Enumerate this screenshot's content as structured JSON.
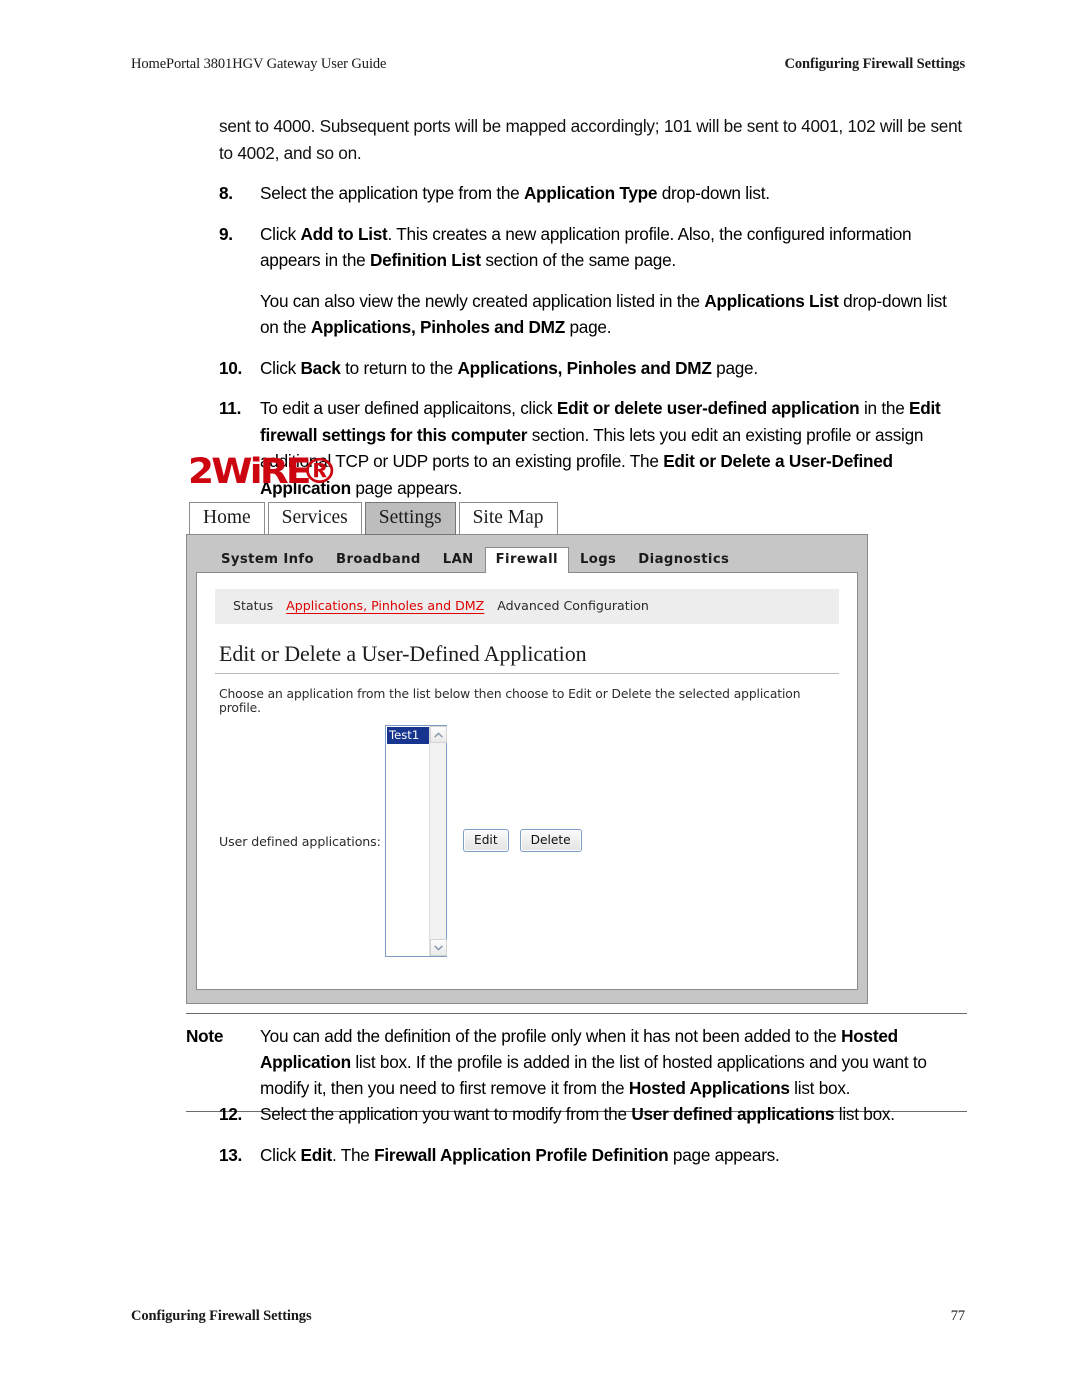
{
  "header": {
    "left": "HomePortal 3801HGV Gateway User Guide",
    "right": "Configuring Firewall Settings"
  },
  "footer": {
    "left": "Configuring Firewall Settings",
    "page_number": "77"
  },
  "body": {
    "lead_paragraph": {
      "line1_a": "sent to 4000. Subsequent ports will be mapped accordingly; 101 will be sent to 4001, 102 will be sent to 4002, and so on."
    },
    "steps": [
      {
        "number": "8.",
        "parts": [
          {
            "text": "Select the application type from the ",
            "bold": false
          },
          {
            "text": "Application Type",
            "bold": true
          },
          {
            "text": " drop-down list.",
            "bold": false
          }
        ]
      },
      {
        "number": "9.",
        "parts": [
          {
            "text": "Click ",
            "bold": false
          },
          {
            "text": "Add to List",
            "bold": true
          },
          {
            "text": ". This creates a new application profile. Also, the configured information appears in the ",
            "bold": false
          },
          {
            "text": "Definition List",
            "bold": true
          },
          {
            "text": " section of the same page.",
            "bold": false
          }
        ]
      }
    ],
    "sub_paragraph": [
      {
        "text": "You can also view the newly created application listed in the ",
        "bold": false
      },
      {
        "text": "Applications List",
        "bold": true
      },
      {
        "text": " drop-down list on the ",
        "bold": false
      },
      {
        "text": "Applications, Pinholes and DMZ",
        "bold": true
      },
      {
        "text": " page.",
        "bold": false
      }
    ],
    "steps2": [
      {
        "number": "10.",
        "parts": [
          {
            "text": "Click ",
            "bold": false
          },
          {
            "text": "Back",
            "bold": true
          },
          {
            "text": " to return to the ",
            "bold": false
          },
          {
            "text": "Applications, Pinholes and DMZ",
            "bold": true
          },
          {
            "text": " page.",
            "bold": false
          }
        ]
      },
      {
        "number": "11.",
        "parts": [
          {
            "text": "To edit a user defined applicaitons, click ",
            "bold": false
          },
          {
            "text": "Edit or delete user-defined application",
            "bold": true
          },
          {
            "text": " in the ",
            "bold": false
          },
          {
            "text": "Edit firewall settings for this computer",
            "bold": true
          },
          {
            "text": " section. This lets you edit an existing profile or assign additional TCP or UDP ports to an existing profile. The ",
            "bold": false
          },
          {
            "text": "Edit or Delete a User-Defined Application",
            "bold": true
          },
          {
            "text": " page appears.",
            "bold": false
          }
        ]
      }
    ],
    "steps3": [
      {
        "number": "12.",
        "parts": [
          {
            "text": "Select the application you want to modify from the ",
            "bold": false
          },
          {
            "text": "User defined applications",
            "bold": true
          },
          {
            "text": " list box.",
            "bold": false
          }
        ]
      },
      {
        "number": "13.",
        "parts": [
          {
            "text": "Click ",
            "bold": false
          },
          {
            "text": "Edit",
            "bold": true
          },
          {
            "text": ". The ",
            "bold": false
          },
          {
            "text": "Firewall Application Profile Definition",
            "bold": true
          },
          {
            "text": " page appears.",
            "bold": false
          }
        ]
      }
    ],
    "note": {
      "label": "Note",
      "parts": [
        {
          "text": "You can add the definition of the profile only when it has not been added to the ",
          "bold": false
        },
        {
          "text": "Hosted Application",
          "bold": true
        },
        {
          "text": " list box. If the profile is added in the list of hosted applications and you want to modify it, then you need to first remove it from the ",
          "bold": false
        },
        {
          "text": "Hosted Applications",
          "bold": true
        },
        {
          "text": " list box.",
          "bold": false
        }
      ]
    }
  },
  "screenshot": {
    "logo": {
      "text": "2WiRE",
      "registered_mark": "®",
      "color": "#cc0511"
    },
    "primary_tabs": [
      {
        "label": "Home",
        "active": false
      },
      {
        "label": "Services",
        "active": false
      },
      {
        "label": "Settings",
        "active": true
      },
      {
        "label": "Site Map",
        "active": false
      }
    ],
    "secondary_tabs": [
      {
        "label": "System Info",
        "active": false
      },
      {
        "label": "Broadband",
        "active": false
      },
      {
        "label": "LAN",
        "active": false
      },
      {
        "label": "Firewall",
        "active": true
      },
      {
        "label": "Logs",
        "active": false
      },
      {
        "label": "Diagnostics",
        "active": false
      }
    ],
    "subnav": [
      {
        "label": "Status",
        "active": false
      },
      {
        "label": "Applications, Pinholes and DMZ",
        "active": true
      },
      {
        "label": "Advanced Configuration",
        "active": false
      }
    ],
    "subnav_active_color": "#e00000",
    "page_title": "Edit or Delete a User-Defined Application",
    "intro_text": "Choose an application from the list below then choose to Edit or Delete the selected application profile.",
    "form": {
      "label": "User defined applications:",
      "listbox": {
        "options": [
          "Test1"
        ],
        "selected": "Test1",
        "selection_color": "#17358f"
      },
      "buttons": [
        {
          "label": "Edit"
        },
        {
          "label": "Delete"
        }
      ]
    }
  }
}
